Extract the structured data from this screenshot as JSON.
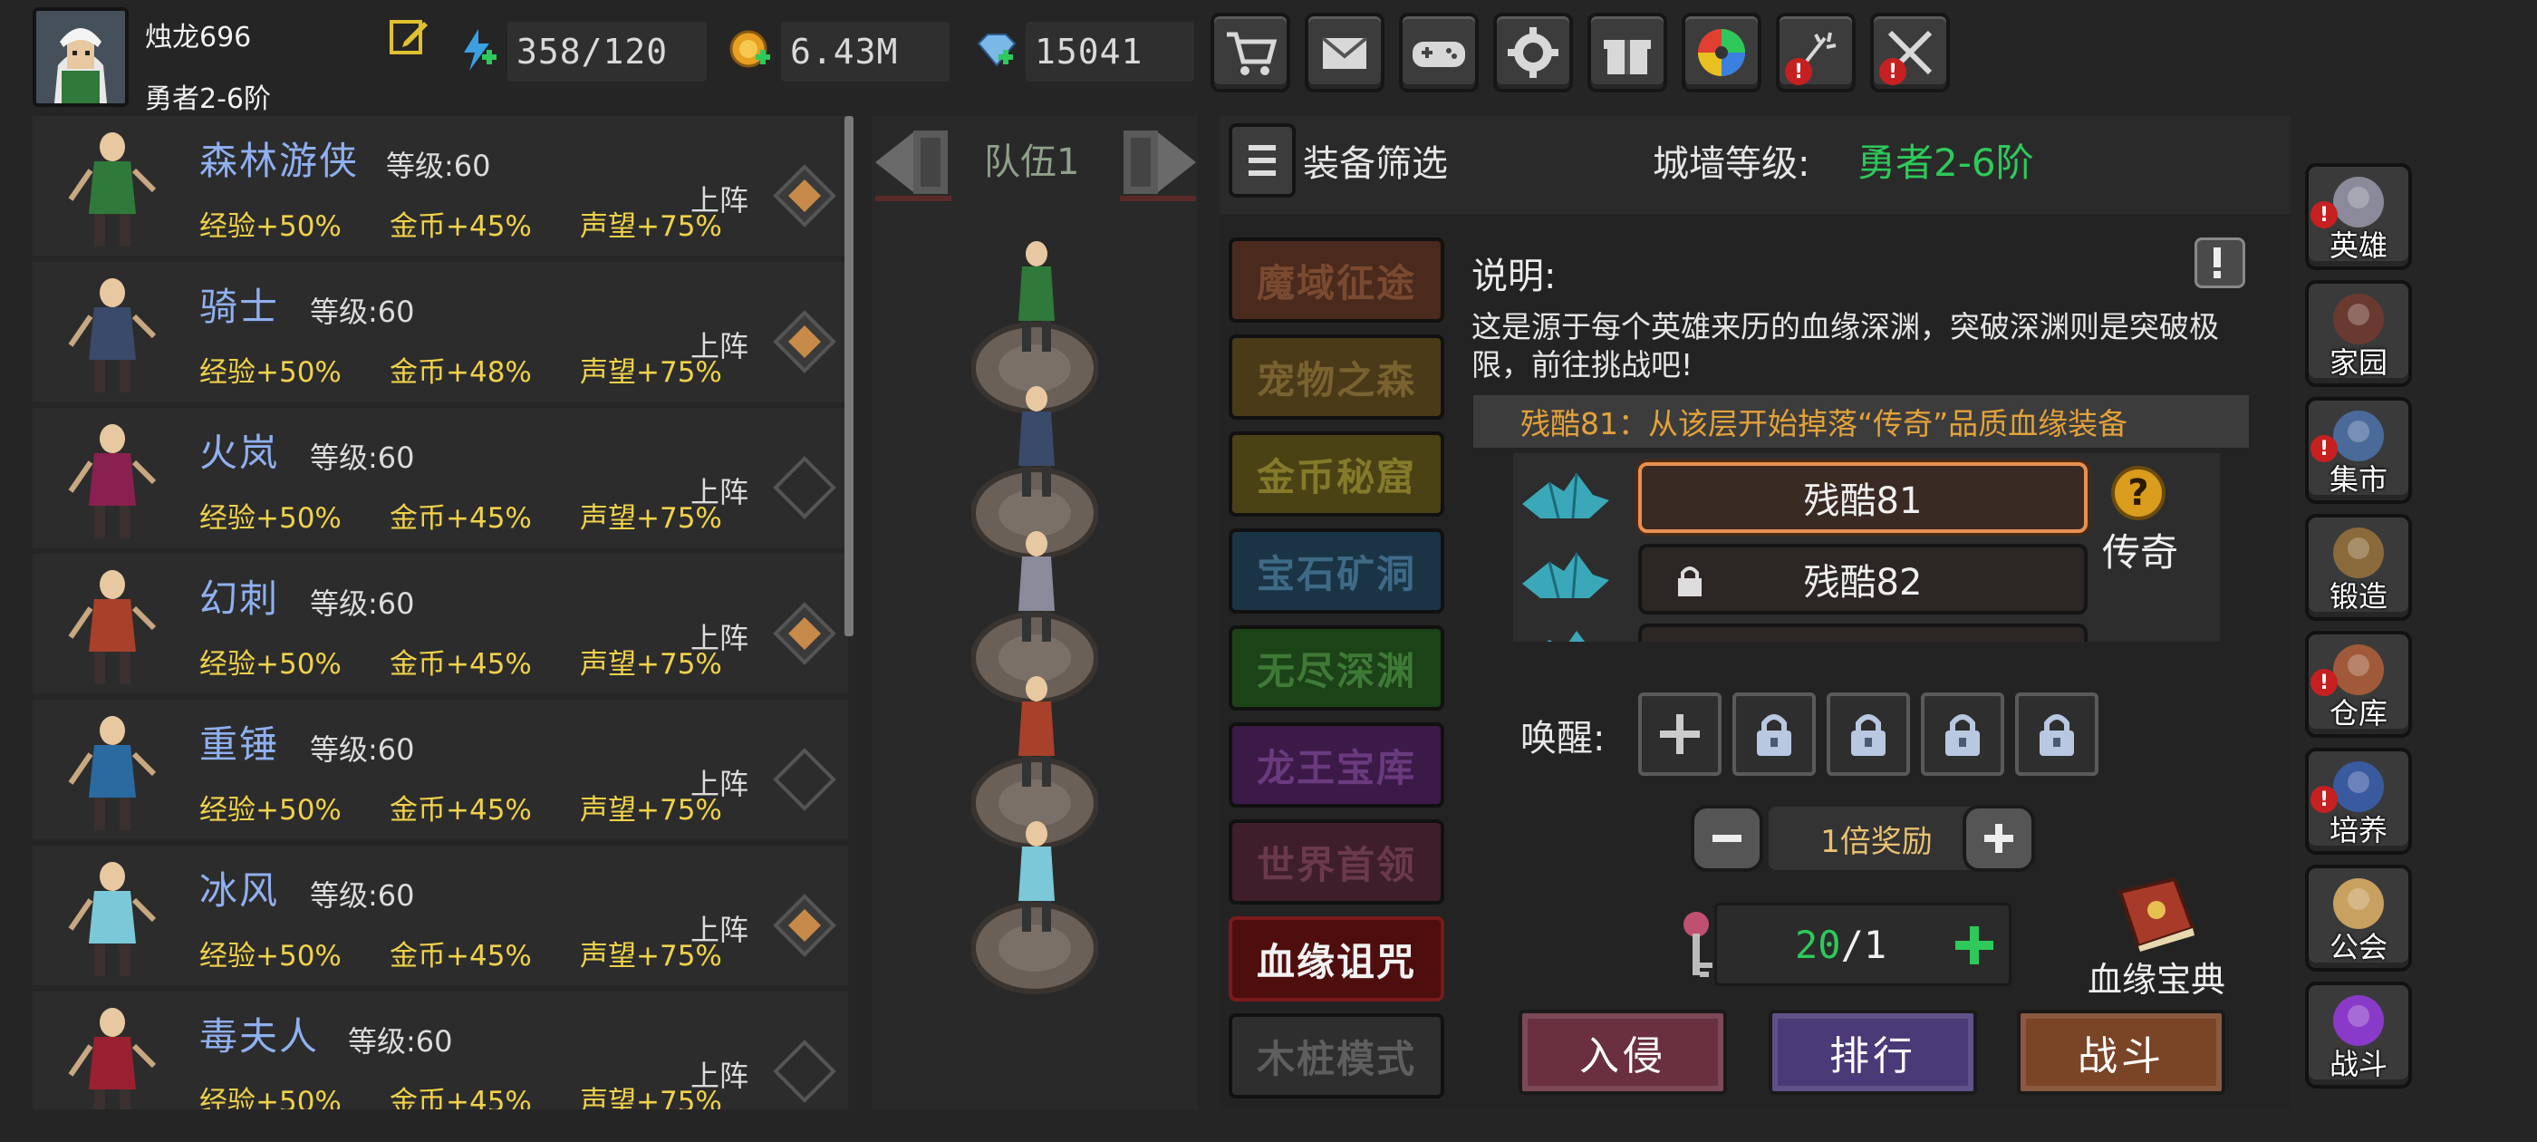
{
  "player": {
    "name": "烛龙696",
    "rank": "勇者2-6阶"
  },
  "resources": {
    "energy": "358/120",
    "gold": "6.43M",
    "gems": "15041"
  },
  "top_buttons": [
    {
      "icon": "shop-cart-icon",
      "alert": false
    },
    {
      "icon": "mail-icon",
      "alert": false
    },
    {
      "icon": "gamepad-icon",
      "alert": false
    },
    {
      "icon": "gear-icon",
      "alert": false
    },
    {
      "icon": "gift-icon",
      "alert": false
    },
    {
      "icon": "color-wheel-icon",
      "alert": false
    },
    {
      "icon": "fireworks-icon",
      "alert": true
    },
    {
      "icon": "crossed-swords-icon",
      "alert": true
    }
  ],
  "alert_mark": "!",
  "heroes": [
    {
      "name": "森林游侠",
      "level": "等级:60",
      "exp": "经验+50%",
      "gold": "金币+45%",
      "fame": "声望+75%",
      "deploy": "上阵",
      "deployed": true,
      "color": "#2f7a3a"
    },
    {
      "name": "骑士",
      "level": "等级:60",
      "exp": "经验+50%",
      "gold": "金币+48%",
      "fame": "声望+75%",
      "deploy": "上阵",
      "deployed": true,
      "color": "#3a4a6a"
    },
    {
      "name": "火岚",
      "level": "等级:60",
      "exp": "经验+50%",
      "gold": "金币+45%",
      "fame": "声望+75%",
      "deploy": "上阵",
      "deployed": false,
      "color": "#8a2050"
    },
    {
      "name": "幻刺",
      "level": "等级:60",
      "exp": "经验+50%",
      "gold": "金币+45%",
      "fame": "声望+75%",
      "deploy": "上阵",
      "deployed": true,
      "color": "#a8402a"
    },
    {
      "name": "重锤",
      "level": "等级:60",
      "exp": "经验+50%",
      "gold": "金币+45%",
      "fame": "声望+75%",
      "deploy": "上阵",
      "deployed": false,
      "color": "#2a6aa0"
    },
    {
      "name": "冰风",
      "level": "等级:60",
      "exp": "经验+50%",
      "gold": "金币+45%",
      "fame": "声望+75%",
      "deploy": "上阵",
      "deployed": true,
      "color": "#7ac8d8"
    },
    {
      "name": "毒夫人",
      "level": "等级:60",
      "exp": "经验+50%",
      "gold": "金币+45%",
      "fame": "声望+75%",
      "deploy": "上阵",
      "deployed": false,
      "color": "#9a2030"
    }
  ],
  "team": {
    "title": "队伍1",
    "members": [
      "森林游侠",
      "骑士",
      "银发剑客",
      "幻刺",
      "冰风"
    ]
  },
  "filter": {
    "label": "装备筛选"
  },
  "wall": {
    "label": "城墙等级:",
    "value": "勇者2-6阶"
  },
  "modes": [
    {
      "label": "魔域征途",
      "bg": "#4a2a1c",
      "fg": "#7a4a30",
      "active": false
    },
    {
      "label": "宠物之森",
      "bg": "#4a3a18",
      "fg": "#7a6230",
      "active": false
    },
    {
      "label": "金币秘窟",
      "bg": "#4a4214",
      "fg": "#857a2a",
      "active": false
    },
    {
      "label": "宝石矿洞",
      "bg": "#1a3446",
      "fg": "#3e6a86",
      "active": false
    },
    {
      "label": "无尽深渊",
      "bg": "#1c4218",
      "fg": "#3e7a36",
      "active": false
    },
    {
      "label": "龙王宝库",
      "bg": "#3c1a48",
      "fg": "#6a3a7e",
      "active": false
    },
    {
      "label": "世界首领",
      "bg": "#3e1e2a",
      "fg": "#6a3a4c",
      "active": false
    },
    {
      "label": "血缘诅咒",
      "bg": "#4e0e0e",
      "fg": "#f2f2f2",
      "active": true
    },
    {
      "label": "木桩模式",
      "bg": "#2e2e2e",
      "fg": "#5e5e5e",
      "active": false
    }
  ],
  "description": {
    "title": "说明:",
    "text": "这是源于每个英雄来历的血缘深渊，突破深渊则是突破极限，前往挑战吧!",
    "highlight": "残酷81：从该层开始掉落“传奇”品质血缘装备"
  },
  "layers": [
    {
      "label": "残酷81",
      "locked": false
    },
    {
      "label": "残酷82",
      "locked": true
    }
  ],
  "rarity": {
    "mark": "?",
    "label": "传奇"
  },
  "awaken": {
    "label": "唤醒:",
    "slots": [
      "add",
      "locked",
      "locked",
      "locked",
      "locked"
    ]
  },
  "reward_multiplier": "1倍奖励",
  "tickets": {
    "current": "20",
    "max": "/1"
  },
  "codex": {
    "label": "血缘宝典"
  },
  "actions": [
    {
      "label": "入侵",
      "color": "#6a3040"
    },
    {
      "label": "排行",
      "color": "#4a3a78"
    },
    {
      "label": "战斗",
      "color": "#7a4426"
    }
  ],
  "side_nav": [
    {
      "label": "英雄",
      "icon": "helmet-icon",
      "alert": true
    },
    {
      "label": "家园",
      "icon": "castle-icon",
      "alert": false
    },
    {
      "label": "集市",
      "icon": "market-stall-icon",
      "alert": true
    },
    {
      "label": "锻造",
      "icon": "anvil-icon",
      "alert": false
    },
    {
      "label": "仓库",
      "icon": "warehouse-chest-icon",
      "alert": true
    },
    {
      "label": "培养",
      "icon": "goblet-icon",
      "alert": true
    },
    {
      "label": "公会",
      "icon": "guild-crest-icon",
      "alert": false
    },
    {
      "label": "战斗",
      "icon": "portal-icon",
      "alert": false
    }
  ]
}
